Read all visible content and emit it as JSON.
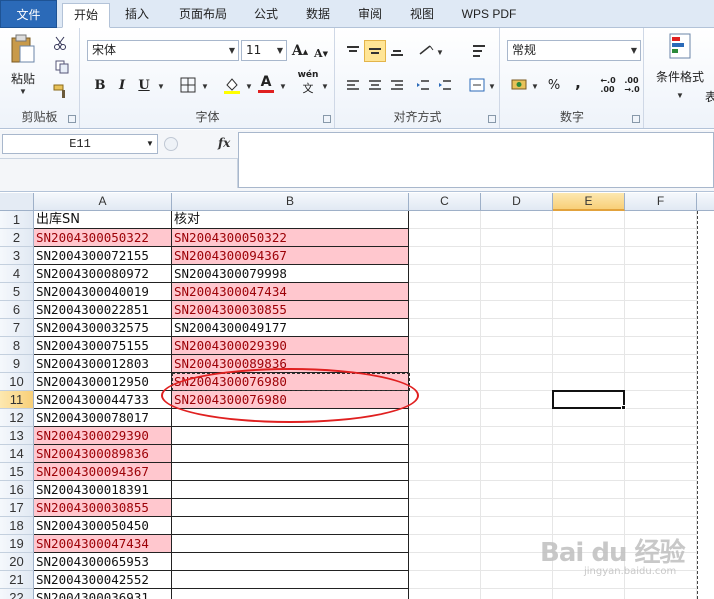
{
  "tabs": [
    "文件",
    "开始",
    "插入",
    "页面布局",
    "公式",
    "数据",
    "审阅",
    "视图",
    "WPS PDF"
  ],
  "active_tab": "开始",
  "ribbon": {
    "clipboard": {
      "paste_label": "粘贴",
      "group_label": "剪贴板"
    },
    "font": {
      "font_name": "宋体",
      "font_size": "11",
      "bold": "B",
      "italic": "I",
      "underline": "U",
      "grow": "A",
      "shrink": "A",
      "wen": "wén",
      "group_label": "字体"
    },
    "alignment": {
      "group_label": "对齐方式"
    },
    "number": {
      "format": "常规",
      "percent": "%",
      "comma": ",",
      "group_label": "数字"
    },
    "styles": {
      "conditional_label": "条件格式",
      "partial_label": "表"
    }
  },
  "formula_bar": {
    "name_box": "E11",
    "fx": "fx",
    "formula": ""
  },
  "columns": [
    "A",
    "B",
    "C",
    "D",
    "E",
    "F"
  ],
  "selected_column": "E",
  "rows": [
    {
      "num": "1",
      "a": "出库SN",
      "a_pink": false,
      "b": "核对",
      "b_pink": false
    },
    {
      "num": "2",
      "a": "SN2004300050322",
      "a_pink": true,
      "b": "SN2004300050322",
      "b_pink": true
    },
    {
      "num": "3",
      "a": "SN2004300072155",
      "a_pink": false,
      "b": "SN2004300094367",
      "b_pink": true
    },
    {
      "num": "4",
      "a": "SN2004300080972",
      "a_pink": false,
      "b": "SN2004300079998",
      "b_pink": false
    },
    {
      "num": "5",
      "a": "SN2004300040019",
      "a_pink": false,
      "b": "SN2004300047434",
      "b_pink": true
    },
    {
      "num": "6",
      "a": "SN2004300022851",
      "a_pink": false,
      "b": "SN2004300030855",
      "b_pink": true
    },
    {
      "num": "7",
      "a": "SN2004300032575",
      "a_pink": false,
      "b": "SN2004300049177",
      "b_pink": false
    },
    {
      "num": "8",
      "a": "SN2004300075155",
      "a_pink": false,
      "b": "SN2004300029390",
      "b_pink": true
    },
    {
      "num": "9",
      "a": "SN2004300012803",
      "a_pink": false,
      "b": "SN2004300089836",
      "b_pink": true
    },
    {
      "num": "10",
      "a": "SN2004300012950",
      "a_pink": false,
      "b": "SN2004300076980",
      "b_pink": true
    },
    {
      "num": "11",
      "a": "SN2004300044733",
      "a_pink": false,
      "b": "SN2004300076980",
      "b_pink": true
    },
    {
      "num": "12",
      "a": "SN2004300078017",
      "a_pink": false,
      "b": "",
      "b_pink": false
    },
    {
      "num": "13",
      "a": "SN2004300029390",
      "a_pink": true,
      "b": "",
      "b_pink": false
    },
    {
      "num": "14",
      "a": "SN2004300089836",
      "a_pink": true,
      "b": "",
      "b_pink": false
    },
    {
      "num": "15",
      "a": "SN2004300094367",
      "a_pink": true,
      "b": "",
      "b_pink": false
    },
    {
      "num": "16",
      "a": "SN2004300018391",
      "a_pink": false,
      "b": "",
      "b_pink": false
    },
    {
      "num": "17",
      "a": "SN2004300030855",
      "a_pink": true,
      "b": "",
      "b_pink": false
    },
    {
      "num": "18",
      "a": "SN2004300050450",
      "a_pink": false,
      "b": "",
      "b_pink": false
    },
    {
      "num": "19",
      "a": "SN2004300047434",
      "a_pink": true,
      "b": "",
      "b_pink": false
    },
    {
      "num": "20",
      "a": "SN2004300065953",
      "a_pink": false,
      "b": "",
      "b_pink": false
    },
    {
      "num": "21",
      "a": "SN2004300042552",
      "a_pink": false,
      "b": "",
      "b_pink": false
    },
    {
      "num": "22",
      "a": "SN2004300036931",
      "a_pink": false,
      "b": "",
      "b_pink": false
    }
  ],
  "watermark": {
    "main": "Bai du 经验",
    "sub": "jingyan.baidu.com"
  },
  "colors": {
    "duplicate_fill": "#ffc7ce",
    "duplicate_text": "#9c0006",
    "annotation": "#e02020",
    "file_tab": "#2b6ab8"
  }
}
